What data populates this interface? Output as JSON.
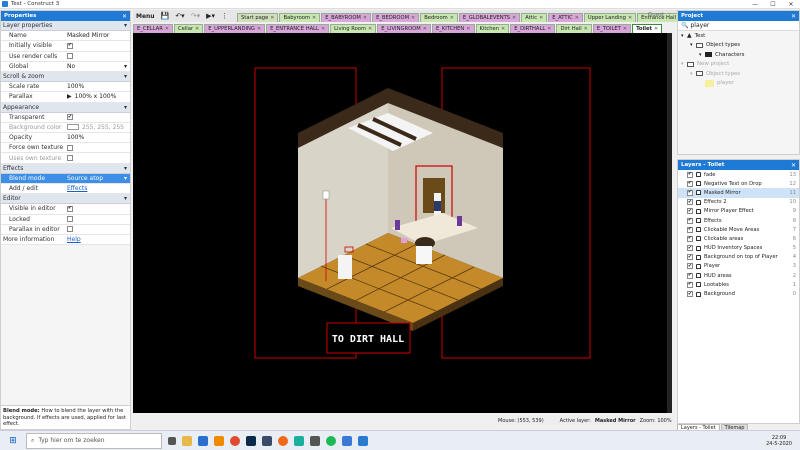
{
  "window": {
    "title": "Test - Construct 3",
    "controls": [
      "—",
      "☐",
      "✕"
    ]
  },
  "properties": {
    "header": "Properties",
    "sections": [
      {
        "type": "section",
        "label": "Layer properties"
      },
      {
        "type": "row",
        "key": "Name",
        "value": "Masked Mirror"
      },
      {
        "type": "row",
        "key": "Initially visible",
        "check": true
      },
      {
        "type": "row",
        "key": "Use render cells",
        "check": false
      },
      {
        "type": "row",
        "key": "Global",
        "value": "No",
        "dropdown": true
      },
      {
        "type": "section",
        "label": "Scroll & zoom"
      },
      {
        "type": "row",
        "key": "Scale rate",
        "value": "100%"
      },
      {
        "type": "row",
        "key": "Parallax",
        "value": "100% x 100%",
        "arrow": true
      },
      {
        "type": "section",
        "label": "Appearance"
      },
      {
        "type": "row",
        "key": "Transparent",
        "check": true
      },
      {
        "type": "row",
        "key": "Background color",
        "value": "255, 255, 255",
        "swatch": true,
        "dim": true
      },
      {
        "type": "row",
        "key": "Opacity",
        "value": "100%"
      },
      {
        "type": "row",
        "key": "Force own texture",
        "check": false
      },
      {
        "type": "row",
        "key": "Uses own texture",
        "check": false,
        "dim": true
      },
      {
        "type": "section",
        "label": "Effects"
      },
      {
        "type": "row",
        "key": "Blend mode",
        "value": "Source atop",
        "dropdown": true,
        "selected": true
      },
      {
        "type": "row",
        "key": "Add / edit",
        "value": "Effects",
        "link": true
      },
      {
        "type": "section",
        "label": "Editor"
      },
      {
        "type": "row",
        "key": "Visible in editor",
        "check": true
      },
      {
        "type": "row",
        "key": "Locked",
        "check": false
      },
      {
        "type": "row",
        "key": "Parallax in editor",
        "check": false
      },
      {
        "type": "row",
        "key": "More information",
        "value": "Help",
        "link": true,
        "noindent": true
      }
    ],
    "help_title": "Blend mode:",
    "help_text": " How to blend the layer with the background. If effects are used, applied for last effect."
  },
  "toolbar": {
    "menu": "Menu"
  },
  "tabs_row1": [
    {
      "label": "Start page",
      "color": "#cfe0b8"
    },
    {
      "label": "Babyroom",
      "color": "#c8e6b0"
    },
    {
      "label": "E_BABYROOM",
      "color": "#d9a6d9"
    },
    {
      "label": "E_BEDROOM",
      "color": "#d9a6d9"
    },
    {
      "label": "Bedroom",
      "color": "#c8e6b0"
    },
    {
      "label": "E_GLOBALEVENTS",
      "color": "#d9a6d9"
    },
    {
      "label": "Attic",
      "color": "#c8e6b0"
    },
    {
      "label": "E_ATTIC",
      "color": "#d9a6d9"
    },
    {
      "label": "Upper Landing",
      "color": "#c8e6b0"
    },
    {
      "label": "Entrance Hall",
      "color": "#c8e6b0"
    }
  ],
  "tabs_row2": [
    {
      "label": "E_CELLAR",
      "color": "#d9a6d9"
    },
    {
      "label": "Cellar",
      "color": "#c8e6b0"
    },
    {
      "label": "E_UPPERLANDING",
      "color": "#d9a6d9"
    },
    {
      "label": "E_ENTRANCE HALL",
      "color": "#d9a6d9"
    },
    {
      "label": "Living Room",
      "color": "#c8e6b0"
    },
    {
      "label": "E_LIVINGROOM",
      "color": "#d9a6d9"
    },
    {
      "label": "E_KITCHEN",
      "color": "#d9a6d9"
    },
    {
      "label": "Kitchen",
      "color": "#c8e6b0"
    },
    {
      "label": "E_DIRTHALL",
      "color": "#d9a6d9"
    },
    {
      "label": "Dirt Hall",
      "color": "#c8e6b0"
    },
    {
      "label": "E_TOILET",
      "color": "#d9a6d9"
    },
    {
      "label": "Toilet",
      "color": "#ffffff",
      "active": true
    }
  ],
  "guest": "Guest",
  "canvas": {
    "sign_text": "TO DIRT HALL"
  },
  "statusbar": {
    "mouse": "Mouse: (553, 539)",
    "active_layer_label": "Active layer:",
    "active_layer": "Masked Mirror",
    "zoom": "Zoom: 100%"
  },
  "project": {
    "header": "Project",
    "search": "player",
    "tree": [
      {
        "label": "Test",
        "indent": 0,
        "icon": "triangle"
      },
      {
        "label": "Object types",
        "indent": 1,
        "icon": "folder"
      },
      {
        "label": "Characters",
        "indent": 2,
        "icon": "folder-dark"
      },
      {
        "label": "New project",
        "indent": 0,
        "icon": "folder",
        "dim": true
      },
      {
        "label": "Object types",
        "indent": 1,
        "icon": "folder",
        "dim": true
      },
      {
        "label": "player",
        "indent": 2,
        "icon": "sprite",
        "dim": true
      }
    ]
  },
  "layers": {
    "header": "Layers - Toilet",
    "items": [
      {
        "name": "fade",
        "num": "13"
      },
      {
        "name": "Negative Text on Drop",
        "num": "12"
      },
      {
        "name": "Masked Mirror",
        "num": "11",
        "selected": true
      },
      {
        "name": "Effects 2",
        "num": "10"
      },
      {
        "name": "Mirror Player Effect",
        "num": "9"
      },
      {
        "name": "Effects",
        "num": "8"
      },
      {
        "name": "Clickable Move Areas",
        "num": "7"
      },
      {
        "name": "Clickable areas",
        "num": "6"
      },
      {
        "name": "HUD Inventory Spaces",
        "num": "5"
      },
      {
        "name": "Background on top of Player",
        "num": "4"
      },
      {
        "name": "Player",
        "num": "3"
      },
      {
        "name": "HUD areas",
        "num": "2"
      },
      {
        "name": "Lootables",
        "num": "1"
      },
      {
        "name": "Background",
        "num": "0"
      }
    ],
    "bottom_tabs": [
      "Layers - Toilet",
      "Tilemap"
    ]
  },
  "taskbar": {
    "search": "Typ hier om te zoeken",
    "time": "22:09",
    "date": "24-5-2020"
  }
}
